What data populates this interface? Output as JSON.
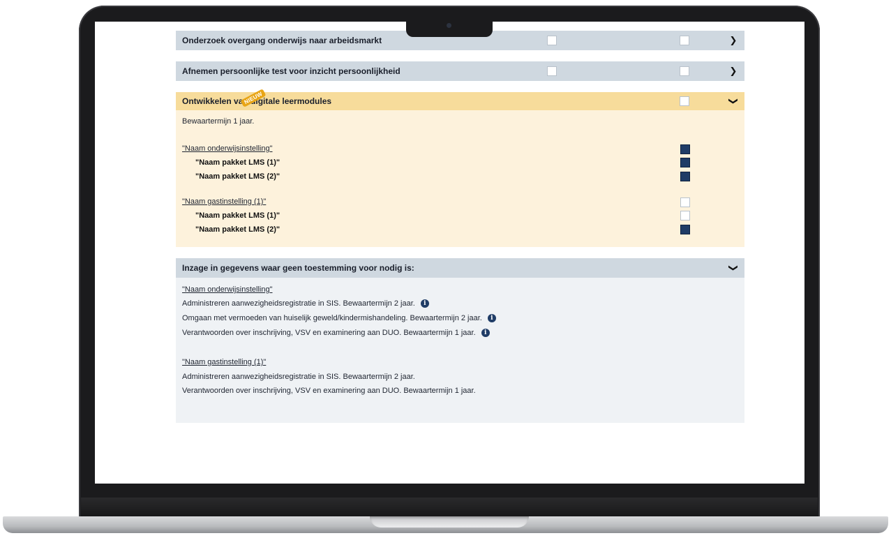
{
  "rows": [
    {
      "title": "Onderzoek overgang onderwijs naar arbeidsmarkt",
      "state": "collapsed"
    },
    {
      "title": "Afnemen persoonlijke test voor inzicht persoonlijkheid",
      "state": "collapsed"
    }
  ],
  "expanded": {
    "badge": "NIEUW",
    "title": "Ontwikkelen van digitale leermodules",
    "retention": "Bewaartermijn 1 jaar.",
    "groups": [
      {
        "institution": "\"Naam onderwijsinstelling\"",
        "checked": true,
        "items": [
          {
            "label": "\"Naam pakket LMS (1)\"",
            "checked": true
          },
          {
            "label": "\"Naam pakket LMS (2)\"",
            "checked": true
          }
        ]
      },
      {
        "institution": "\"Naam gastinstelling (1)\"",
        "checked": false,
        "items": [
          {
            "label": "\"Naam pakket LMS (1)\"",
            "checked": false
          },
          {
            "label": "\"Naam pakket LMS (2)\"",
            "checked": true
          }
        ]
      }
    ]
  },
  "inzage": {
    "title": "Inzage in gegevens waar geen toestemming voor nodig is:",
    "groups": [
      {
        "institution": "\"Naam onderwijsinstelling\"",
        "lines": [
          {
            "text": "Administreren aanwezigheidsregistratie in SIS. Bewaartermijn 2 jaar.",
            "info": true
          },
          {
            "text": "Omgaan met vermoeden van huiselijk geweld/kindermishandeling. Bewaartermijn 2 jaar.",
            "info": true
          },
          {
            "text": "Verantwoorden over inschrijving, VSV en examinering aan DUO. Bewaartermijn 1 jaar.",
            "info": true
          }
        ]
      },
      {
        "institution": "\"Naam gastinstelling (1)\"",
        "lines": [
          {
            "text": "Administreren aanwezigheidsregistratie in SIS. Bewaartermijn 2 jaar.",
            "info": false
          },
          {
            "text": "Verantwoorden over inschrijving, VSV en examinering aan DUO. Bewaartermijn 1 jaar.",
            "info": false
          }
        ]
      }
    ]
  },
  "icons": {
    "chevron_right": "chevron-right-icon",
    "chevron_down": "chevron-down-icon",
    "info": "info-icon"
  },
  "colors": {
    "row_grey": "#cfd8e0",
    "row_yellow": "#f7dc9b",
    "panel_yellow": "#fdf2dc",
    "panel_grey": "#eff2f5",
    "checkbox_filled": "#1f3c66",
    "badge": "#e8a516"
  }
}
